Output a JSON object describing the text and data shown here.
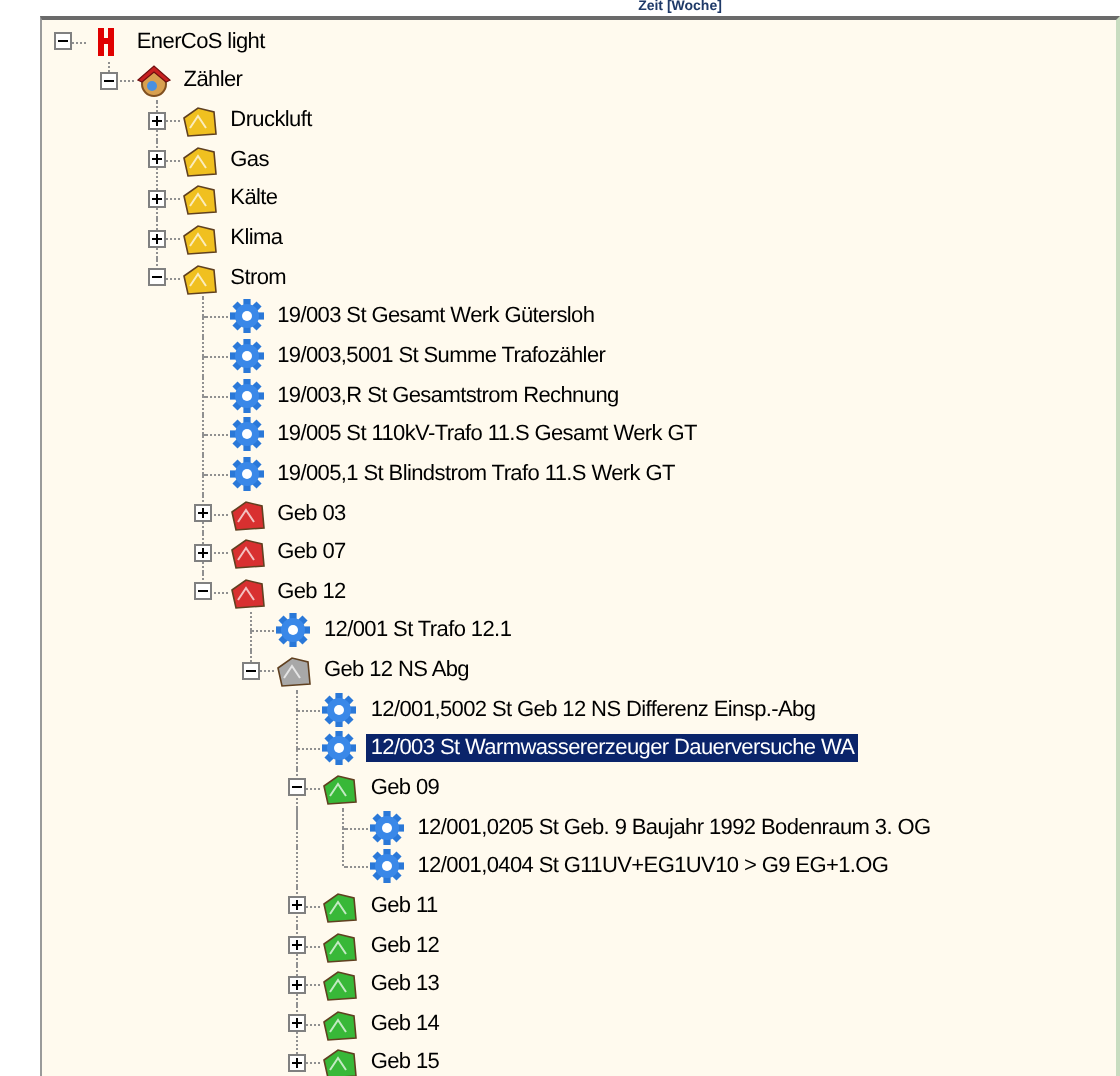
{
  "header": {
    "title": "Zeit [Woche]"
  },
  "tree": [
    {
      "label": "EnerCoS light",
      "kind": "root",
      "expanded": true,
      "selected": false,
      "children": [
        {
          "label": "Zähler",
          "kind": "house",
          "expanded": true,
          "selected": false,
          "children": [
            {
              "label": "Druckluft",
              "kind": "folder",
              "color": "#f0c020",
              "expanded": false,
              "selected": false
            },
            {
              "label": "Gas",
              "kind": "folder",
              "color": "#f0c020",
              "expanded": false,
              "selected": false
            },
            {
              "label": "Kälte",
              "kind": "folder",
              "color": "#f0c020",
              "expanded": false,
              "selected": false
            },
            {
              "label": "Klima",
              "kind": "folder",
              "color": "#f0c020",
              "expanded": false,
              "selected": false
            },
            {
              "label": "Strom",
              "kind": "folder",
              "color": "#f0c020",
              "expanded": true,
              "selected": false,
              "children": [
                {
                  "label": "19/003 St Gesamt Werk Gütersloh",
                  "kind": "meter",
                  "selected": false
                },
                {
                  "label": "19/003,5001 St Summe Trafozähler",
                  "kind": "meter",
                  "selected": false
                },
                {
                  "label": "19/003,R St Gesamtstrom Rechnung",
                  "kind": "meter",
                  "selected": false
                },
                {
                  "label": "19/005 St 110kV-Trafo 11.S Gesamt Werk GT",
                  "kind": "meter",
                  "selected": false
                },
                {
                  "label": "19/005,1 St Blindstrom Trafo 11.S Werk GT",
                  "kind": "meter",
                  "selected": false
                },
                {
                  "label": "Geb 03",
                  "kind": "folder",
                  "color": "#d83030",
                  "expanded": false,
                  "selected": false
                },
                {
                  "label": "Geb 07",
                  "kind": "folder",
                  "color": "#d83030",
                  "expanded": false,
                  "selected": false
                },
                {
                  "label": "Geb 12",
                  "kind": "folder",
                  "color": "#d83030",
                  "expanded": true,
                  "selected": false,
                  "children": [
                    {
                      "label": "12/001 St Trafo 12.1",
                      "kind": "meter",
                      "selected": false
                    },
                    {
                      "label": "Geb 12 NS Abg",
                      "kind": "folder",
                      "color": "#a8a8a8",
                      "expanded": true,
                      "selected": false,
                      "children": [
                        {
                          "label": "12/001,5002 St Geb 12 NS Differenz Einsp.-Abg",
                          "kind": "meter",
                          "selected": false
                        },
                        {
                          "label": "12/003 St Warmwassererzeuger Dauerversuche WA",
                          "kind": "meter",
                          "selected": true
                        },
                        {
                          "label": "Geb 09",
                          "kind": "folder",
                          "color": "#38b838",
                          "expanded": true,
                          "selected": false,
                          "children": [
                            {
                              "label": "12/001,0205 St Geb. 9 Baujahr 1992 Bodenraum 3. OG",
                              "kind": "meter",
                              "selected": false
                            },
                            {
                              "label": "12/001,0404 St G11UV+EG1UV10 > G9 EG+1.OG",
                              "kind": "meter",
                              "selected": false
                            }
                          ]
                        },
                        {
                          "label": "Geb 11",
                          "kind": "folder",
                          "color": "#38b838",
                          "expanded": false,
                          "selected": false
                        },
                        {
                          "label": "Geb 12",
                          "kind": "folder",
                          "color": "#38b838",
                          "expanded": false,
                          "selected": false
                        },
                        {
                          "label": "Geb 13",
                          "kind": "folder",
                          "color": "#38b838",
                          "expanded": false,
                          "selected": false
                        },
                        {
                          "label": "Geb 14",
                          "kind": "folder",
                          "color": "#38b838",
                          "expanded": false,
                          "selected": false
                        },
                        {
                          "label": "Geb 15",
                          "kind": "folder",
                          "color": "#38b838",
                          "expanded": false,
                          "selected": false
                        }
                      ]
                    }
                  ]
                }
              ]
            }
          ]
        }
      ]
    }
  ]
}
